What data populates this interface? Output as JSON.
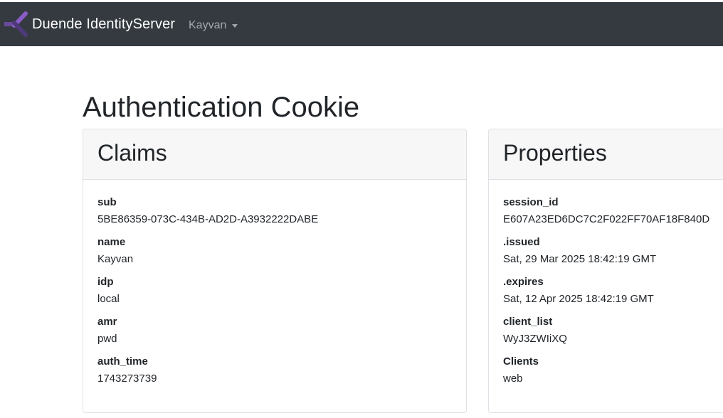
{
  "navbar": {
    "brand": "Duende IdentityServer",
    "user": "Kayvan"
  },
  "page": {
    "title": "Authentication Cookie"
  },
  "claims": {
    "header": "Claims",
    "items": [
      {
        "key": "sub",
        "value": "5BE86359-073C-434B-AD2D-A3932222DABE"
      },
      {
        "key": "name",
        "value": "Kayvan"
      },
      {
        "key": "idp",
        "value": "local"
      },
      {
        "key": "amr",
        "value": "pwd"
      },
      {
        "key": "auth_time",
        "value": "1743273739"
      }
    ]
  },
  "properties": {
    "header": "Properties",
    "items": [
      {
        "key": "session_id",
        "value": "E607A23ED6DC7C2F022FF70AF18F840D"
      },
      {
        "key": ".issued",
        "value": "Sat, 29 Mar 2025 18:42:19 GMT"
      },
      {
        "key": ".expires",
        "value": "Sat, 12 Apr 2025 18:42:19 GMT"
      },
      {
        "key": "client_list",
        "value": "WyJ3ZWIiXQ"
      },
      {
        "key": "Clients",
        "value": "web"
      }
    ]
  },
  "colors": {
    "navbar_bg": "#343a40",
    "logo_purple": "#7b4fb4",
    "card_header_bg": "#f7f7f7",
    "card_border": "#dee2e6"
  },
  "icons": {
    "brand_logo": "duende-logo-icon",
    "user_menu_caret": "caret-down-icon"
  }
}
